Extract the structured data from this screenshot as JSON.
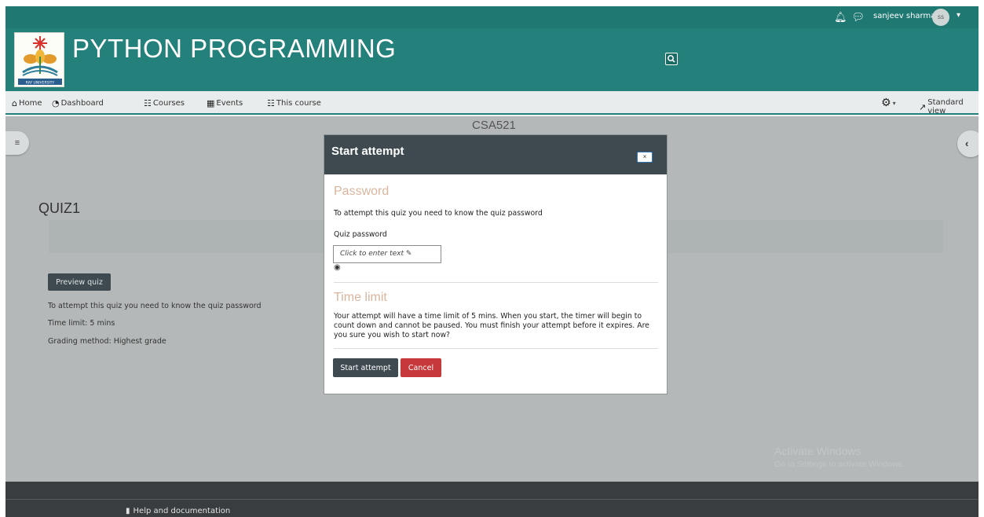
{
  "topbar": {
    "icons": [
      "bell-icon",
      "chat-icon"
    ],
    "username": "sanjeev sharma",
    "avatar_initials": "ss"
  },
  "header": {
    "site_title": "PYTHON PROGRAMMING",
    "logo_text": "RAY UNIVERSITY",
    "brand_color": "#23807a"
  },
  "navbar": {
    "items": [
      {
        "label": "Home",
        "icon": "home-icon"
      },
      {
        "label": "Dashboard",
        "icon": "dashboard-icon"
      },
      {
        "label": "Courses",
        "icon": "grid-icon"
      },
      {
        "label": "Events",
        "icon": "calendar-icon"
      },
      {
        "label": "This course",
        "icon": "sitemap-icon"
      }
    ],
    "right_label": "Standard view"
  },
  "page": {
    "course_code": "CSA521",
    "quiz_title": "QUIZ1",
    "preview_button": "Preview quiz",
    "info_lines": [
      "To attempt this quiz you need to know the quiz password",
      "Time limit: 5 mins",
      "Grading method: Highest grade"
    ]
  },
  "modal": {
    "title": "Start attempt",
    "close_label": "×",
    "password_heading": "Password",
    "password_desc": "To attempt this quiz you need to know the quiz password",
    "password_field_label": "Quiz password",
    "password_placeholder": "Click to enter text",
    "time_heading": "Time limit",
    "time_desc_lines": [
      "Your attempt will have a time limit of 5 mins. When you start, the timer will begin to",
      "count down and cannot be paused. You must finish your attempt before it expires. Are",
      "you sure you wish to start now?"
    ],
    "start_button": "Start attempt",
    "cancel_button": "Cancel"
  },
  "watermark": {
    "title": "Activate Windows",
    "subtitle": "Go to Settings to activate Windows."
  },
  "footer": {
    "help_label": "Help and documentation"
  }
}
